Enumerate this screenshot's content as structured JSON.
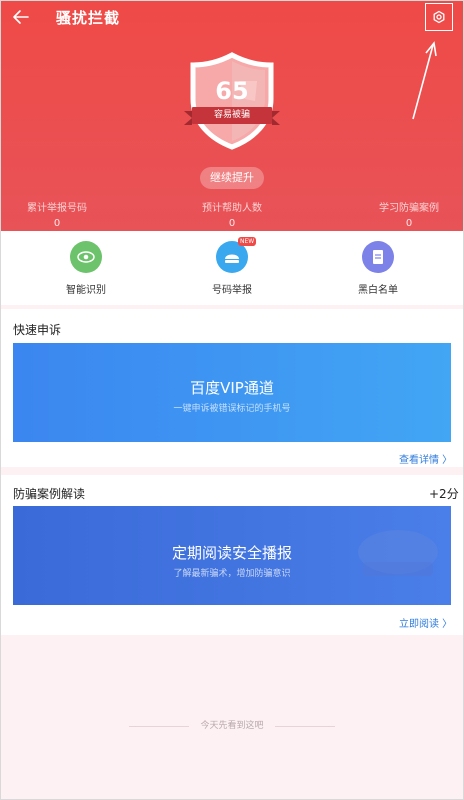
{
  "header": {
    "title": "骚扰拦截",
    "back_icon": "back-arrow-icon",
    "settings_icon": "settings-icon"
  },
  "shield": {
    "score": "65",
    "status": "容易被骗",
    "improve_button": "继续提升"
  },
  "stats": [
    {
      "label": "累计举报号码",
      "value": "0"
    },
    {
      "label": "预计帮助人数",
      "value": "0"
    },
    {
      "label": "学习防骗案例",
      "value": "0"
    }
  ],
  "features": [
    {
      "label": "智能识别",
      "icon": "eye-icon",
      "color": "#6cc36b"
    },
    {
      "label": "号码举报",
      "icon": "report-icon",
      "color": "#3aa8ee",
      "badge": "NEW"
    },
    {
      "label": "黑白名单",
      "icon": "list-icon",
      "color": "#7c82e8"
    }
  ],
  "quick_complaint": {
    "title": "快速申诉",
    "banner_title": "百度VIP通道",
    "banner_sub": "一键申诉被错误标记的手机号",
    "link": "查看详情 〉"
  },
  "fraud_cases": {
    "title": "防骗案例解读",
    "points": "+2分",
    "banner_title": "定期阅读安全播报",
    "banner_sub": "了解最新骗术，增加防骗意识",
    "link": "立即阅读 〉"
  },
  "footer": {
    "text": "今天先看到这吧"
  },
  "colors": {
    "header_red": "#ef4a47",
    "link_blue": "#2f7cde"
  }
}
